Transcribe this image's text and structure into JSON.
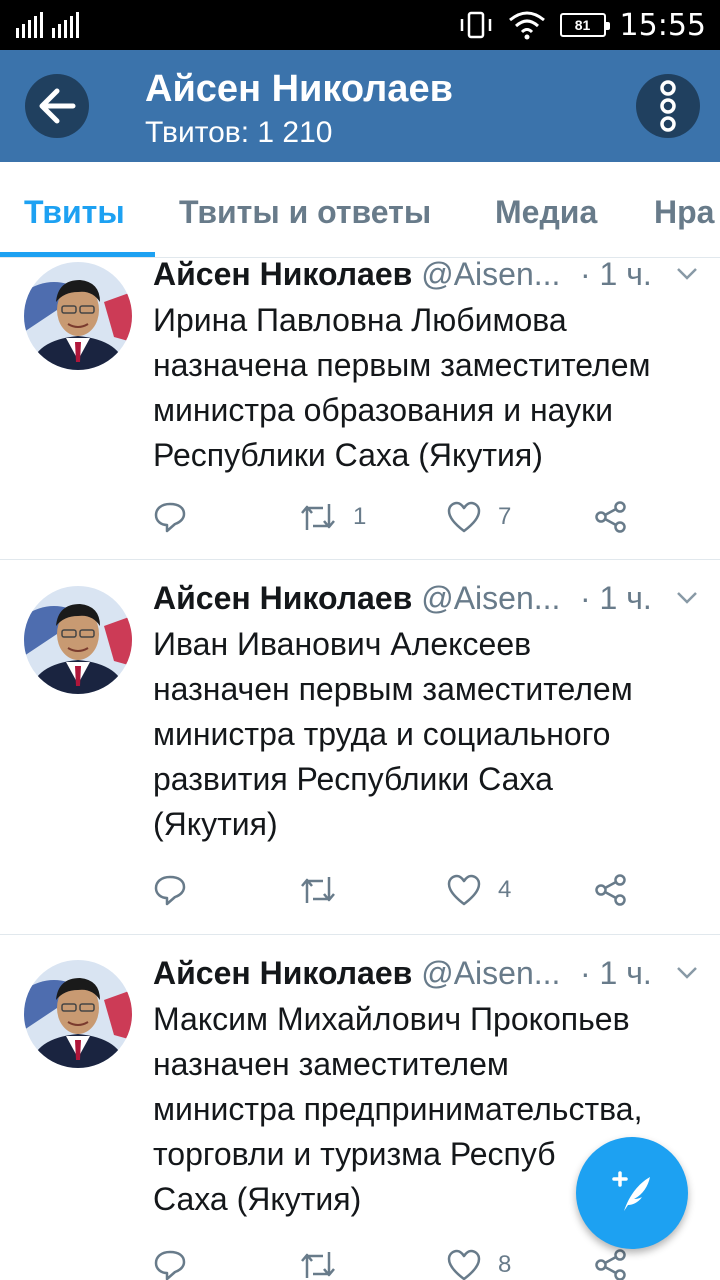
{
  "status_bar": {
    "time": "15:55",
    "battery": "81",
    "icons": [
      "signal-icon",
      "vibrate-icon",
      "wifi-icon",
      "battery-icon"
    ]
  },
  "header": {
    "title": "Айсен Николаев",
    "subtitle": "Твитов: 1 210",
    "back_icon": "arrow-left-icon",
    "menu_icon": "more-vertical-icon"
  },
  "tabs": [
    {
      "label": "Твиты",
      "active": true
    },
    {
      "label": "Твиты и ответы",
      "active": false
    },
    {
      "label": "Медиа",
      "active": false
    },
    {
      "label": "Нра",
      "active": false
    }
  ],
  "tweets": [
    {
      "name": "Айсен Николаев",
      "handle": "@Aisen...",
      "time": "· 1 ч.",
      "text": [
        "Ирина Павловна Любимова",
        "назначена первым заместителем",
        "министра образования и науки",
        "Республики Саха (Якутия)"
      ],
      "reply_count": "",
      "retweet_count": "1",
      "like_count": "7"
    },
    {
      "name": "Айсен Николаев",
      "handle": "@Aisen...",
      "time": "· 1 ч.",
      "text": [
        "Иван Иванович Алексеев",
        "назначен первым заместителем",
        "министра труда и социального",
        "развития Республики Саха",
        "(Якутия)"
      ],
      "reply_count": "",
      "retweet_count": "",
      "like_count": "4"
    },
    {
      "name": "Айсен Николаев",
      "handle": "@Aisen...",
      "time": "· 1 ч.",
      "text": [
        "Максим Михайлович Прокопьев",
        "назначен заместителем",
        "министра предпринимательства,",
        "торговли и туризма Респуб",
        "Саха (Якутия)"
      ],
      "reply_count": "",
      "retweet_count": "",
      "like_count": "8"
    }
  ],
  "fab": {
    "icon": "compose-tweet-icon"
  },
  "colors": {
    "header_bg": "#3b73ab",
    "accent": "#1da1f2",
    "muted": "#687b8a",
    "text": "#14171a"
  }
}
